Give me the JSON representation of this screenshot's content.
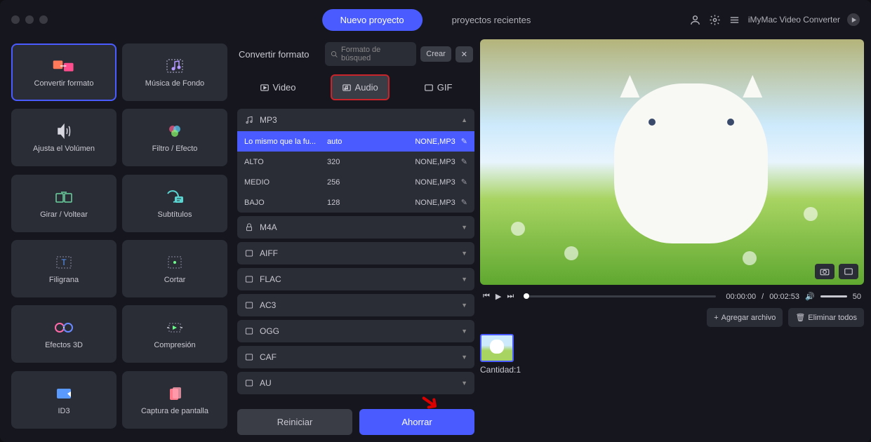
{
  "header": {
    "new_project": "Nuevo proyecto",
    "recent_projects": "proyectos recientes",
    "app_name": "iMyMac Video Converter"
  },
  "sidebar": {
    "tools": [
      {
        "label": "Convertir formato",
        "active": true
      },
      {
        "label": "Música de Fondo"
      },
      {
        "label": "Ajusta el Volúmen"
      },
      {
        "label": "Filtro / Efecto"
      },
      {
        "label": "Girar / Voltear"
      },
      {
        "label": "Subtítulos"
      },
      {
        "label": "Filigrana"
      },
      {
        "label": "Cortar"
      },
      {
        "label": "Efectos 3D"
      },
      {
        "label": "Compresión"
      },
      {
        "label": "ID3"
      },
      {
        "label": "Captura de pantalla"
      }
    ]
  },
  "center": {
    "title": "Convertir formato",
    "search_placeholder": "Formato de búsqued",
    "create": "Crear",
    "type_tabs": {
      "video": "Video",
      "audio": "Audio",
      "gif": "GIF"
    },
    "mp3": {
      "label": "MP3",
      "rows": [
        {
          "name": "Lo mismo que la fu...",
          "br": "auto",
          "codec": "NONE,MP3",
          "sel": true
        },
        {
          "name": "ALTO",
          "br": "320",
          "codec": "NONE,MP3"
        },
        {
          "name": "MEDIO",
          "br": "256",
          "codec": "NONE,MP3"
        },
        {
          "name": "BAJO",
          "br": "128",
          "codec": "NONE,MP3"
        }
      ]
    },
    "formats": [
      "M4A",
      "AIFF",
      "FLAC",
      "AC3",
      "OGG",
      "CAF",
      "AU"
    ],
    "reset": "Reiniciar",
    "save": "Ahorrar"
  },
  "preview": {
    "time_cur": "00:00:00",
    "time_total": "00:02:53",
    "volume": "50",
    "add_file": "Agregar archivo",
    "remove_all": "Eliminar todos",
    "quantity_label": "Cantidad:",
    "quantity_value": "1"
  }
}
